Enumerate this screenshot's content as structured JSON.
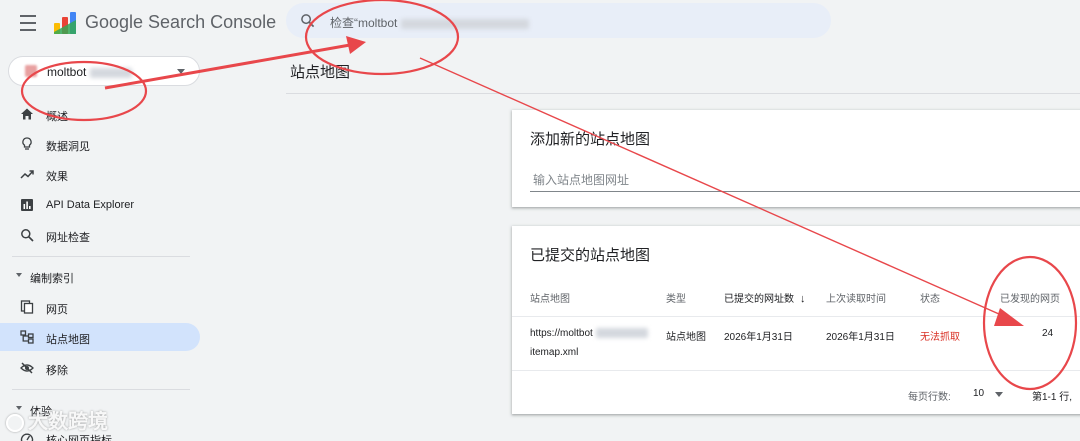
{
  "header": {
    "app_name": "Google Search Console",
    "search_text": "检查“moltbot"
  },
  "property": {
    "name": "moltbot"
  },
  "sidebar": {
    "items": [
      {
        "label": "概述",
        "icon": "home-icon"
      },
      {
        "label": "数据洞见",
        "icon": "lightbulb-icon"
      },
      {
        "label": "效果",
        "icon": "trending-up-icon"
      },
      {
        "label": "API Data Explorer",
        "icon": "bar-chart-icon"
      },
      {
        "label": "网址检查",
        "icon": "search-icon"
      }
    ],
    "section_index": "编制索引",
    "index_items": [
      {
        "label": "网页",
        "icon": "pages-icon"
      },
      {
        "label": "站点地图",
        "icon": "sitemap-icon",
        "active": true
      },
      {
        "label": "移除",
        "icon": "visibility-off-icon"
      }
    ],
    "section_experience": "体验",
    "experience_items": [
      {
        "label": "核心网页指标",
        "icon": "speed-icon"
      }
    ]
  },
  "main": {
    "page_title": "站点地图",
    "add_card": {
      "title": "添加新的站点地图",
      "placeholder": "输入站点地图网址"
    },
    "submitted_card": {
      "title": "已提交的站点地图",
      "columns": [
        "站点地图",
        "类型",
        "已提交的网址数",
        "上次读取时间",
        "状态",
        "已发现的网页"
      ],
      "rows": [
        {
          "sitemap_line1": "https://moltbot",
          "sitemap_line2": "itemap.xml",
          "type": "站点地图",
          "submitted": "2026年1月31日",
          "last_read": "2026年1月31日",
          "status": "无法抓取",
          "discovered": "24"
        }
      ],
      "pager": {
        "rows_per_page_label": "每页行数:",
        "rows_per_page_value": "10",
        "range_text": "第1-1 行,"
      }
    }
  },
  "watermark": {
    "text": "大数跨境"
  },
  "colors": {
    "accent": "#1a73e8",
    "active_nav": "#d2e3fc",
    "error": "#d93025",
    "annotation": "#e8474b"
  }
}
